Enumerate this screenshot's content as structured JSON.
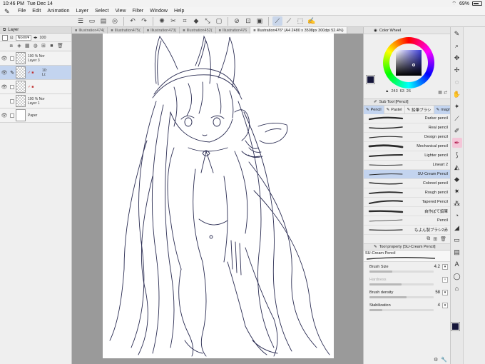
{
  "status_bar": {
    "time": "10:46 PM",
    "date": "Tue Dec 14",
    "battery": "69%",
    "battery_level": 0.69
  },
  "menu": [
    "File",
    "Edit",
    "Animation",
    "Layer",
    "Select",
    "View",
    "Filter",
    "Window",
    "Help"
  ],
  "toolbar": {
    "icons": [
      "menu-icon",
      "new-icon",
      "save-icon",
      "export-icon",
      "undo-icon",
      "redo-icon",
      "loading-icon",
      "cut-icon",
      "select-icon",
      "fill-icon",
      "transform-icon",
      "clear-icon",
      "deselect-icon",
      "invert-icon",
      "frame-icon",
      "ruler-icon",
      "pen-pressure-icon",
      "stabilize-icon",
      "hand-icon"
    ]
  },
  "document_tabs": [
    {
      "label": "Illustration474(",
      "active": false
    },
    {
      "label": "Illustration475(",
      "active": false
    },
    {
      "label": "Illustration473(",
      "active": false
    },
    {
      "label": "Illustration452(",
      "active": false
    },
    {
      "label": "Illustration476",
      "active": false
    },
    {
      "label": "Illustration476* (A4 2480 x 3508px 300dpi 52.4%)",
      "active": true
    }
  ],
  "layer_panel": {
    "title": "Layer",
    "blend_mode": "Norm",
    "opacity": "100",
    "layers": [
      {
        "opacity_label": "100 % Nor",
        "name": "Layer 3",
        "selected": false,
        "visible": true,
        "paper": false
      },
      {
        "opacity_label": "10:",
        "name": "Li:",
        "selected": true,
        "visible": true,
        "paper": false
      },
      {
        "opacity_label": "",
        "name": "",
        "selected": false,
        "visible": true,
        "paper": false
      },
      {
        "opacity_label": "100 % Nor",
        "name": "Layer 1",
        "selected": false,
        "visible": false,
        "paper": false
      },
      {
        "opacity_label": "",
        "name": "Paper",
        "selected": false,
        "visible": true,
        "paper": true
      }
    ]
  },
  "color_wheel": {
    "title": "Color Wheel",
    "h": "243",
    "s": "63",
    "v": "26",
    "main_color": "#15163a",
    "sub_color": "#6b2a34"
  },
  "sub_tool": {
    "title": "Sub Tool [Pencil]",
    "tabs": [
      "Pencil",
      "Pastel",
      "鉛筆ブラシ",
      "magn..."
    ],
    "brushes": [
      {
        "name": "Darker pencil",
        "selected": false
      },
      {
        "name": "Real pencil",
        "selected": false
      },
      {
        "name": "Design pencil",
        "selected": false
      },
      {
        "name": "Mechanical pencil",
        "selected": false
      },
      {
        "name": "Lighter pencil",
        "selected": false
      },
      {
        "name": "Lineart 2",
        "selected": false
      },
      {
        "name": "SU-Cream Pencil",
        "selected": true
      },
      {
        "name": "Colored pencil",
        "selected": false
      },
      {
        "name": "Rough pencil",
        "selected": false
      },
      {
        "name": "Tapered Pencil",
        "selected": false
      },
      {
        "name": "自作ぼて鉛筆",
        "selected": false
      },
      {
        "name": "Pencil",
        "selected": false
      },
      {
        "name": "もよん製ブラシ2赤",
        "selected": false
      }
    ]
  },
  "tool_property": {
    "title": "Tool property [SU-Cream Pencil]",
    "brush_name": "SU-Cream Pencil",
    "props": [
      {
        "label": "Brush Size",
        "value": "4.2",
        "level": 0.35,
        "disabled": false
      },
      {
        "label": "Hardness",
        "value": "",
        "level": 0.5,
        "disabled": true
      },
      {
        "label": "Brush density",
        "value": "58",
        "level": 0.58,
        "disabled": false
      },
      {
        "label": "Stabilization",
        "value": "4",
        "level": 0.2,
        "disabled": false
      }
    ]
  },
  "tools": [
    "pen-icon",
    "zoom-icon",
    "move-layer-icon",
    "move-icon",
    "lasso-icon",
    "hand-icon",
    "sparkle-icon",
    "eyedropper-icon",
    "pencil-icon",
    "pen-active-icon",
    "brush-icon",
    "bucket-icon",
    "eraser-icon",
    "blend-icon",
    "spray-icon",
    "blob-icon",
    "gradient-icon",
    "figure-icon",
    "frame-icon",
    "text-icon",
    "balloon-icon",
    "correct-line-icon"
  ],
  "colors": {
    "accent": "#c3d4ef",
    "canvas_bg": "#9a9a9a",
    "sketch_line": "#2a2c52"
  }
}
